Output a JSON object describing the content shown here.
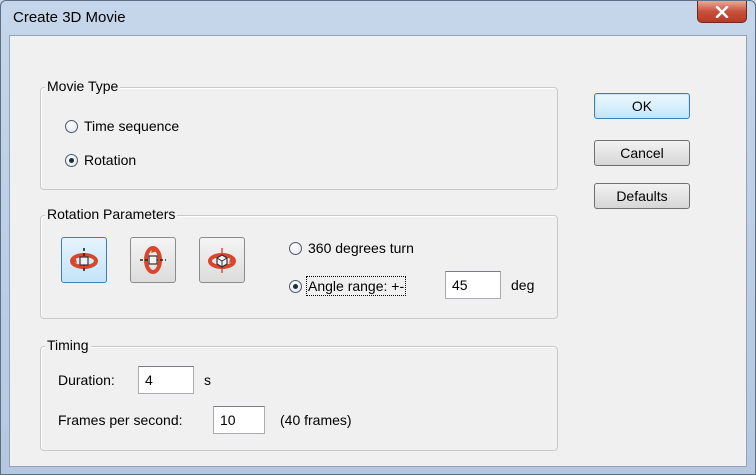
{
  "window": {
    "title": "Create 3D Movie",
    "close_label": "x"
  },
  "movie_type": {
    "title": "Movie Type",
    "options": [
      {
        "label": "Time sequence",
        "checked": false
      },
      {
        "label": "Rotation",
        "checked": true
      }
    ]
  },
  "rotation": {
    "title": "Rotation Parameters",
    "icon_buttons": [
      {
        "name": "rotate-horizontal-icon",
        "active": true
      },
      {
        "name": "rotate-vertical-icon",
        "active": false
      },
      {
        "name": "rotate-3d-icon",
        "active": false
      }
    ],
    "turn_option_label": "360 degrees turn",
    "angle_option_label": "Angle range: +-",
    "angle_value": "45",
    "angle_unit": "deg",
    "selected": "angle"
  },
  "timing": {
    "title": "Timing",
    "duration_label": "Duration:",
    "duration_value": "4",
    "duration_unit": "s",
    "fps_label": "Frames per second:",
    "fps_value": "10",
    "frames_info": "(40 frames)"
  },
  "buttons": {
    "ok": "OK",
    "cancel": "Cancel",
    "defaults": "Defaults"
  },
  "colors": {
    "accent": "#3c7fb1",
    "close": "#c7513b",
    "icon_red": "#d9462b"
  }
}
